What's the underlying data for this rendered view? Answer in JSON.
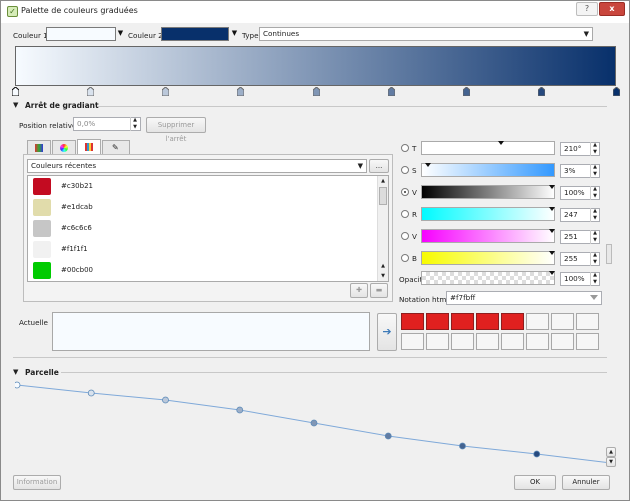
{
  "window": {
    "title": "Palette de couleurs graduées",
    "title_icon": "qgis-icon",
    "help_button": "?",
    "close_button": "x"
  },
  "top": {
    "color1_label": "Couleur 1",
    "color1_value": "#f7fbff",
    "color2_label": "Couleur 2",
    "color2_value": "#08306b",
    "type_label": "Type",
    "type_value": "Continues"
  },
  "ramp": {
    "start": "#f7fbff",
    "end": "#08306b",
    "stop_count": 9
  },
  "gradient_stop": {
    "section_title": "Arrêt de gradiant",
    "position_label": "Position relative",
    "position_value": "0,0%",
    "delete_button": "Supprimer l'arrêt"
  },
  "picker": {
    "tabs": [
      "swatch-grid-icon",
      "color-wheel-icon",
      "palette-icon",
      "eyedropper-icon"
    ],
    "active_tab": 2,
    "recent_label": "Couleurs récentes",
    "more_button": "...",
    "recent_colors": [
      {
        "hex": "#c30b21",
        "label": "#c30b21"
      },
      {
        "hex": "#e1dcab",
        "label": "#e1dcab"
      },
      {
        "hex": "#c6c6c6",
        "label": "#c6c6c6"
      },
      {
        "hex": "#f1f1f1",
        "label": "#f1f1f1"
      },
      {
        "hex": "#00cb00",
        "label": "#00cb00"
      }
    ],
    "add_button_icon": "add-icon",
    "remove_button_icon": "remove-icon"
  },
  "channels": {
    "T": {
      "label": "T",
      "value": "210°",
      "checked": false
    },
    "S": {
      "label": "S",
      "value": "3%",
      "checked": false
    },
    "V": {
      "label": "V",
      "value": "100%",
      "checked": true
    },
    "R": {
      "label": "R",
      "value": "247",
      "checked": false
    },
    "Vg": {
      "label": "V",
      "value": "251",
      "checked": false
    },
    "B": {
      "label": "B",
      "value": "255",
      "checked": false
    },
    "opacity_label": "Opacité",
    "opacity_value": "100%",
    "html_label": "Notation html",
    "html_value": "#f7fbff"
  },
  "current": {
    "label": "Actuelle",
    "color": "#f7fbff",
    "arrow_icon": "arrow-right-icon"
  },
  "swatches": {
    "row1": [
      "#e0201f",
      "#e0201f",
      "#e0201f",
      "#e0201f",
      "#e0201f",
      "",
      "",
      ""
    ],
    "row2": [
      "",
      "",
      "",
      "",
      "",
      "",
      "",
      ""
    ]
  },
  "plot_section": {
    "title": "Parcelle",
    "stop_count": 9
  },
  "buttons": {
    "information": "Information",
    "ok": "OK",
    "cancel": "Annuler"
  }
}
